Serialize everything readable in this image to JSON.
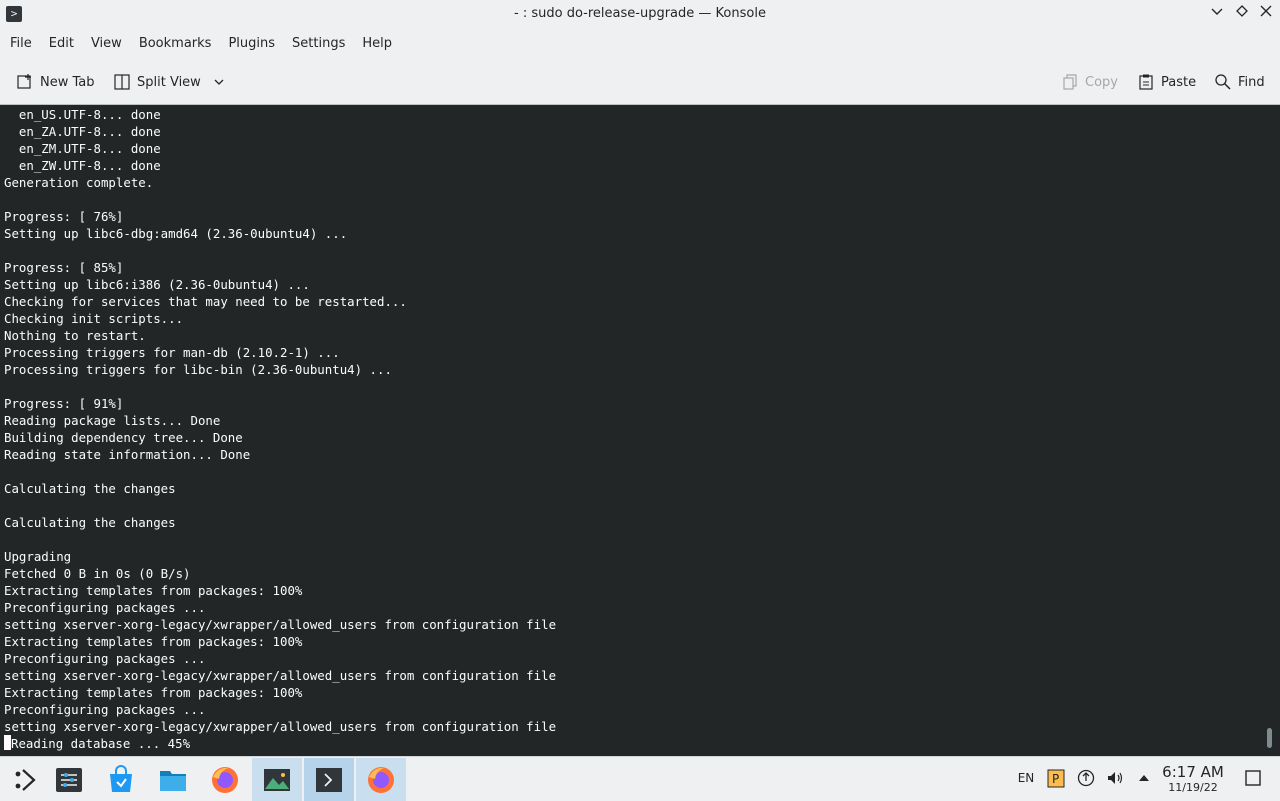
{
  "window": {
    "title": "- : sudo do-release-upgrade — Konsole",
    "app_icon": "terminal-icon",
    "buttons": [
      "minimize",
      "maximize",
      "close"
    ]
  },
  "menu": [
    "File",
    "Edit",
    "View",
    "Bookmarks",
    "Plugins",
    "Settings",
    "Help"
  ],
  "toolbar": {
    "new_tab": "New Tab",
    "split_view": "Split View",
    "copy": "Copy",
    "paste": "Paste",
    "find": "Find"
  },
  "terminal": {
    "lines": [
      "  en_US.UTF-8... done",
      "  en_ZA.UTF-8... done",
      "  en_ZM.UTF-8... done",
      "  en_ZW.UTF-8... done",
      "Generation complete.",
      "",
      "Progress: [ 76%]",
      "Setting up libc6-dbg:amd64 (2.36-0ubuntu4) ...",
      "",
      "Progress: [ 85%]",
      "Setting up libc6:i386 (2.36-0ubuntu4) ...",
      "Checking for services that may need to be restarted...",
      "Checking init scripts...",
      "Nothing to restart.",
      "Processing triggers for man-db (2.10.2-1) ...",
      "Processing triggers for libc-bin (2.36-0ubuntu4) ...",
      "",
      "Progress: [ 91%]",
      "Reading package lists... Done",
      "Building dependency tree... Done",
      "Reading state information... Done",
      "",
      "Calculating the changes",
      "",
      "Calculating the changes",
      "",
      "Upgrading",
      "Fetched 0 B in 0s (0 B/s)",
      "Extracting templates from packages: 100%",
      "Preconfiguring packages ...",
      "setting xserver-xorg-legacy/xwrapper/allowed_users from configuration file",
      "Extracting templates from packages: 100%",
      "Preconfiguring packages ...",
      "setting xserver-xorg-legacy/xwrapper/allowed_users from configuration file",
      "Extracting templates from packages: 100%",
      "Preconfiguring packages ...",
      "setting xserver-xorg-legacy/xwrapper/allowed_users from configuration file"
    ],
    "current_line": "Reading database ... 45%",
    "current_line_prefix": "(",
    "colors": {
      "background": "#232627",
      "foreground": "#fcfcfc"
    }
  },
  "taskbar": {
    "tasks": [
      {
        "name": "application-launcher",
        "icon": "kde-launcher-icon"
      },
      {
        "name": "system-settings",
        "icon": "settings-icon"
      },
      {
        "name": "discover",
        "icon": "discover-store-icon"
      },
      {
        "name": "dolphin",
        "icon": "folder-icon"
      },
      {
        "name": "firefox",
        "icon": "firefox-icon"
      },
      {
        "name": "image-viewer",
        "icon": "image-icon"
      },
      {
        "name": "konsole",
        "icon": "terminal-icon"
      },
      {
        "name": "firefox-active",
        "icon": "firefox-icon"
      }
    ],
    "tray": {
      "keyboard_layout": "EN",
      "icons": [
        "clipboard-icon",
        "update-icon",
        "volume-icon",
        "expand-tray-icon"
      ]
    },
    "clock": {
      "time": "6:17 AM",
      "date": "11/19/22"
    }
  }
}
